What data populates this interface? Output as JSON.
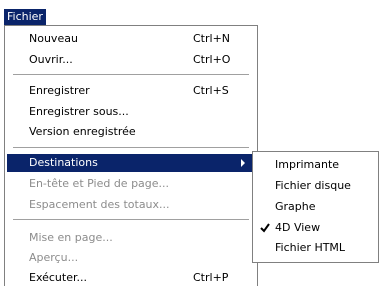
{
  "menubar": {
    "title": "Fichier"
  },
  "menu": {
    "items": [
      {
        "label": "Nouveau",
        "shortcut": "Ctrl+N"
      },
      {
        "label": "Ouvrir...",
        "shortcut": "Ctrl+O"
      },
      {
        "label": "Enregistrer",
        "shortcut": "Ctrl+S"
      },
      {
        "label": "Enregistrer sous...",
        "shortcut": ""
      },
      {
        "label": "Version enregistrée",
        "shortcut": ""
      },
      {
        "label": "Destinations",
        "shortcut": "",
        "state": "highlighted",
        "has_submenu": true
      },
      {
        "label": "En-tête et Pied de page...",
        "shortcut": "",
        "state": "disabled"
      },
      {
        "label": "Espacement des totaux...",
        "shortcut": "",
        "state": "disabled"
      },
      {
        "label": "Mise en page...",
        "shortcut": "",
        "state": "disabled"
      },
      {
        "label": "Aperçu...",
        "shortcut": "",
        "state": "disabled"
      },
      {
        "label": "Exécuter...",
        "shortcut": "Ctrl+P"
      }
    ]
  },
  "submenu": {
    "items": [
      {
        "label": "Imprimante",
        "checked": false
      },
      {
        "label": "Fichier disque",
        "checked": false
      },
      {
        "label": "Graphe",
        "checked": false
      },
      {
        "label": "4D View",
        "checked": true
      },
      {
        "label": "Fichier HTML",
        "checked": false
      }
    ]
  },
  "colors": {
    "highlight": "#0a246a",
    "disabled_text": "#8c8c8c",
    "separator": "#a0a0a0"
  }
}
